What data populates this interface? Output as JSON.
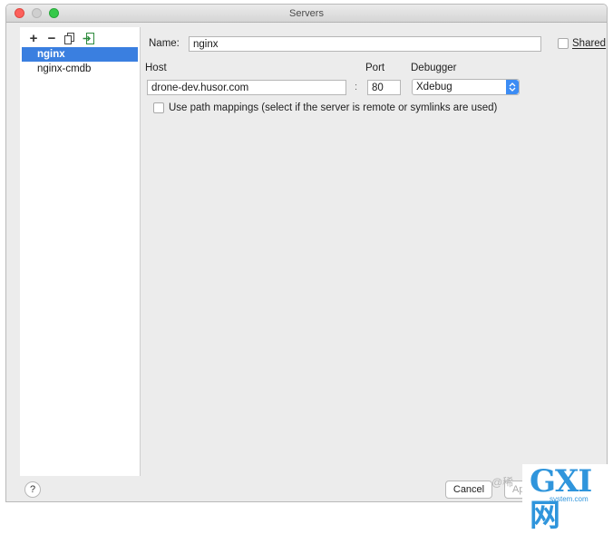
{
  "window": {
    "title": "Servers"
  },
  "toolbar": {
    "add_label": "+",
    "remove_label": "−"
  },
  "servers": [
    {
      "name": "nginx",
      "selected": true
    },
    {
      "name": "nginx-cmdb",
      "selected": false
    }
  ],
  "form": {
    "name_label": "Name:",
    "name_value": "nginx",
    "shared_label": "Shared",
    "shared_checked": false,
    "host_label": "Host",
    "host_value": "drone-dev.husor.com",
    "colon": ":",
    "port_label": "Port",
    "port_value": "80",
    "debugger_label": "Debugger",
    "debugger_value": "Xdebug",
    "path_mappings_label": "Use path mappings (select if the server is remote or symlinks are used)",
    "path_mappings_checked": false
  },
  "footer": {
    "help_label": "?",
    "cancel_label": "Cancel",
    "apply_partial": "Ap"
  },
  "watermark": {
    "faint_text": "@稀",
    "logo": "GXI网",
    "domain": "system.com"
  },
  "colors": {
    "selection": "#3a7fe0",
    "select_arrow": "#3c8cf4",
    "watermark": "#2f95dc"
  }
}
